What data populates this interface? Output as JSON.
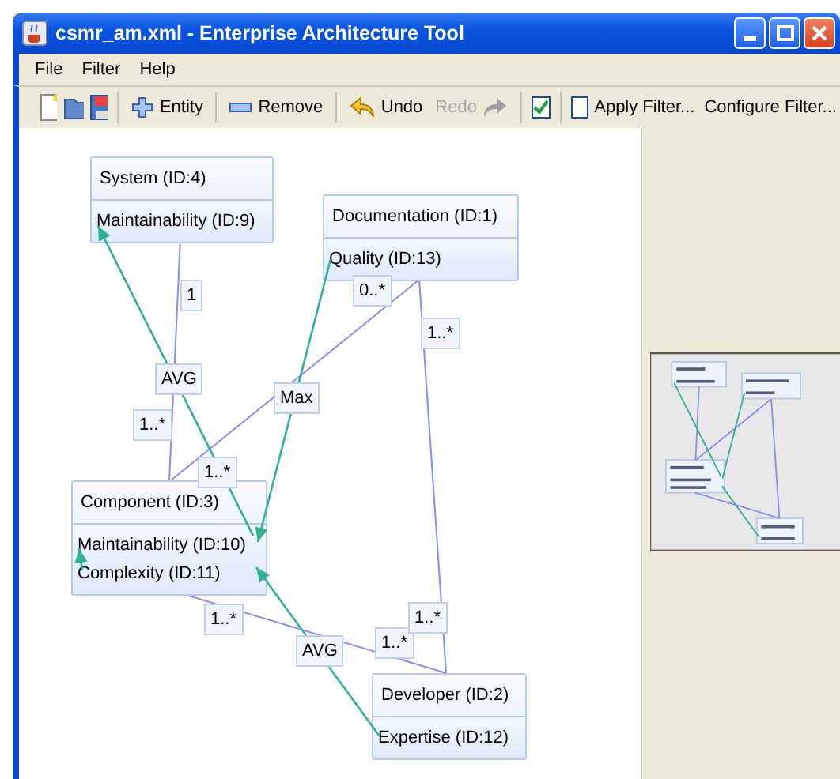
{
  "window": {
    "title": "csmr_am.xml - Enterprise Architecture Tool"
  },
  "menu": [
    "File",
    "Filter",
    "Help"
  ],
  "toolbar": {
    "entity": "Entity",
    "remove": "Remove",
    "undo": {
      "label": "Undo",
      "disabled": false
    },
    "redo": {
      "label": "Redo",
      "disabled": true
    },
    "toggle": {
      "checked": true
    },
    "apply_filter": {
      "label": "Apply Filter...",
      "checked": false
    },
    "configure_filter": "Configure Filter..."
  },
  "diagram": {
    "entities": [
      {
        "title": "System (ID:4)",
        "attributes": [
          "Maintainability (ID:9)"
        ]
      },
      {
        "title": "Documentation (ID:1)",
        "attributes": [
          "Quality (ID:13)"
        ]
      },
      {
        "title": "Component (ID:3)",
        "attributes": [
          "Maintainability (ID:10)",
          "Complexity (ID:11)"
        ]
      },
      {
        "title": "Developer (ID:2)",
        "attributes": [
          "Expertise (ID:12)"
        ]
      }
    ],
    "labels": [
      "1",
      "AVG",
      "1..*",
      "Max",
      "0..*",
      "1..*",
      "1..*",
      "1..*",
      "AVG",
      "1..*",
      "1..*"
    ]
  }
}
